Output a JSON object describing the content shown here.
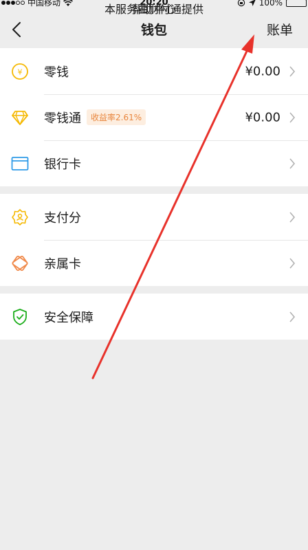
{
  "status_bar": {
    "carrier": "中国移动",
    "time": "20:20",
    "battery": "100%"
  },
  "nav": {
    "title": "钱包",
    "right_action": "账单"
  },
  "groups": [
    {
      "items": [
        {
          "label": "零钱",
          "value": "¥0.00",
          "icon": "coin-icon"
        },
        {
          "label": "零钱通",
          "badge": "收益率2.61%",
          "value": "¥0.00",
          "icon": "diamond-icon"
        },
        {
          "label": "银行卡",
          "value": "",
          "icon": "bank-card-icon"
        }
      ]
    },
    {
      "items": [
        {
          "label": "支付分",
          "value": "",
          "icon": "pay-score-icon"
        },
        {
          "label": "亲属卡",
          "value": "",
          "icon": "family-card-icon"
        }
      ]
    },
    {
      "items": [
        {
          "label": "安全保障",
          "value": "",
          "icon": "shield-icon"
        }
      ]
    }
  ],
  "footer": {
    "help": "帮助中心",
    "provider": "本服务由财付通提供"
  },
  "colors": {
    "accent_yellow": "#f5b800",
    "card_blue": "#2f9be8",
    "orange": "#f08a4b",
    "green": "#1aad19",
    "link": "#576b95",
    "annotation_red": "#e8322b"
  }
}
